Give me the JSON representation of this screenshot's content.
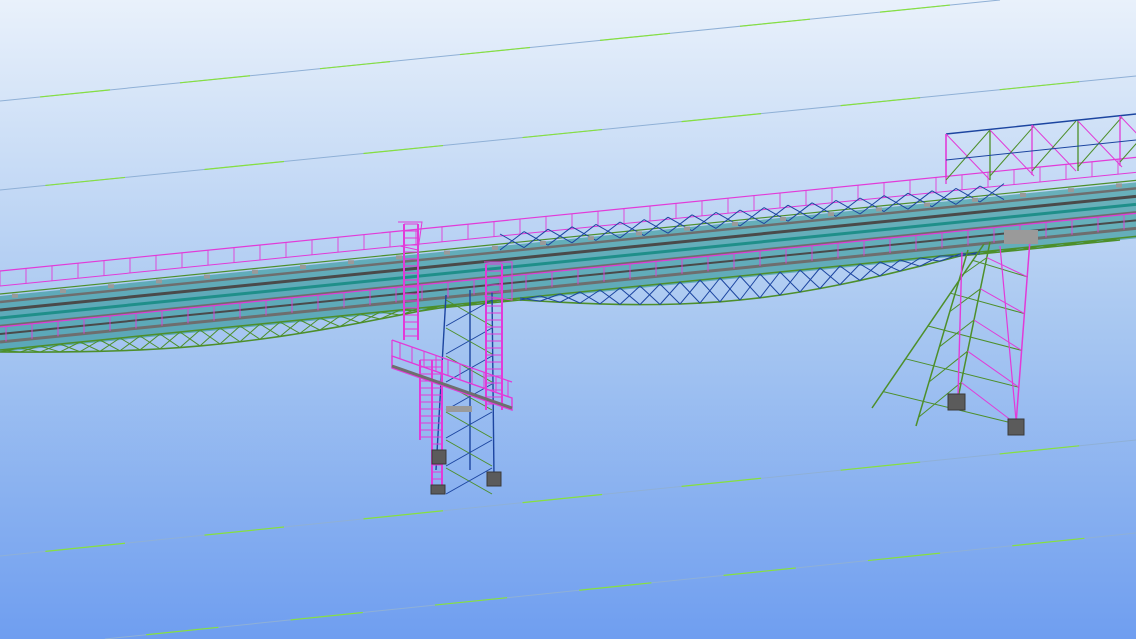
{
  "viewport": {
    "sky_top": "#e9f1fb",
    "sky_mid": "#a9c8f1",
    "sky_bottom": "#6f9ef0"
  },
  "colors": {
    "grid_line": "#8fb0d6",
    "grid_highlight": "#86e03f",
    "handrail": "#e23ad8",
    "truss_green": "#4d8f2a",
    "truss_blue": "#1c45a0",
    "deck_grey": "#6e6e6e",
    "belt_teal": "#1f8f8a",
    "belt_dark": "#4a4a4a",
    "footing": "#5b5b5b",
    "bracket_grey": "#9a9a9a"
  },
  "scene_parts": [
    "conveyor-gallery",
    "walkway-handrail",
    "lower-truss",
    "support-tower-left",
    "access-ladder",
    "access-platform",
    "support-tower-right",
    "roof-frame",
    "column-footings"
  ]
}
